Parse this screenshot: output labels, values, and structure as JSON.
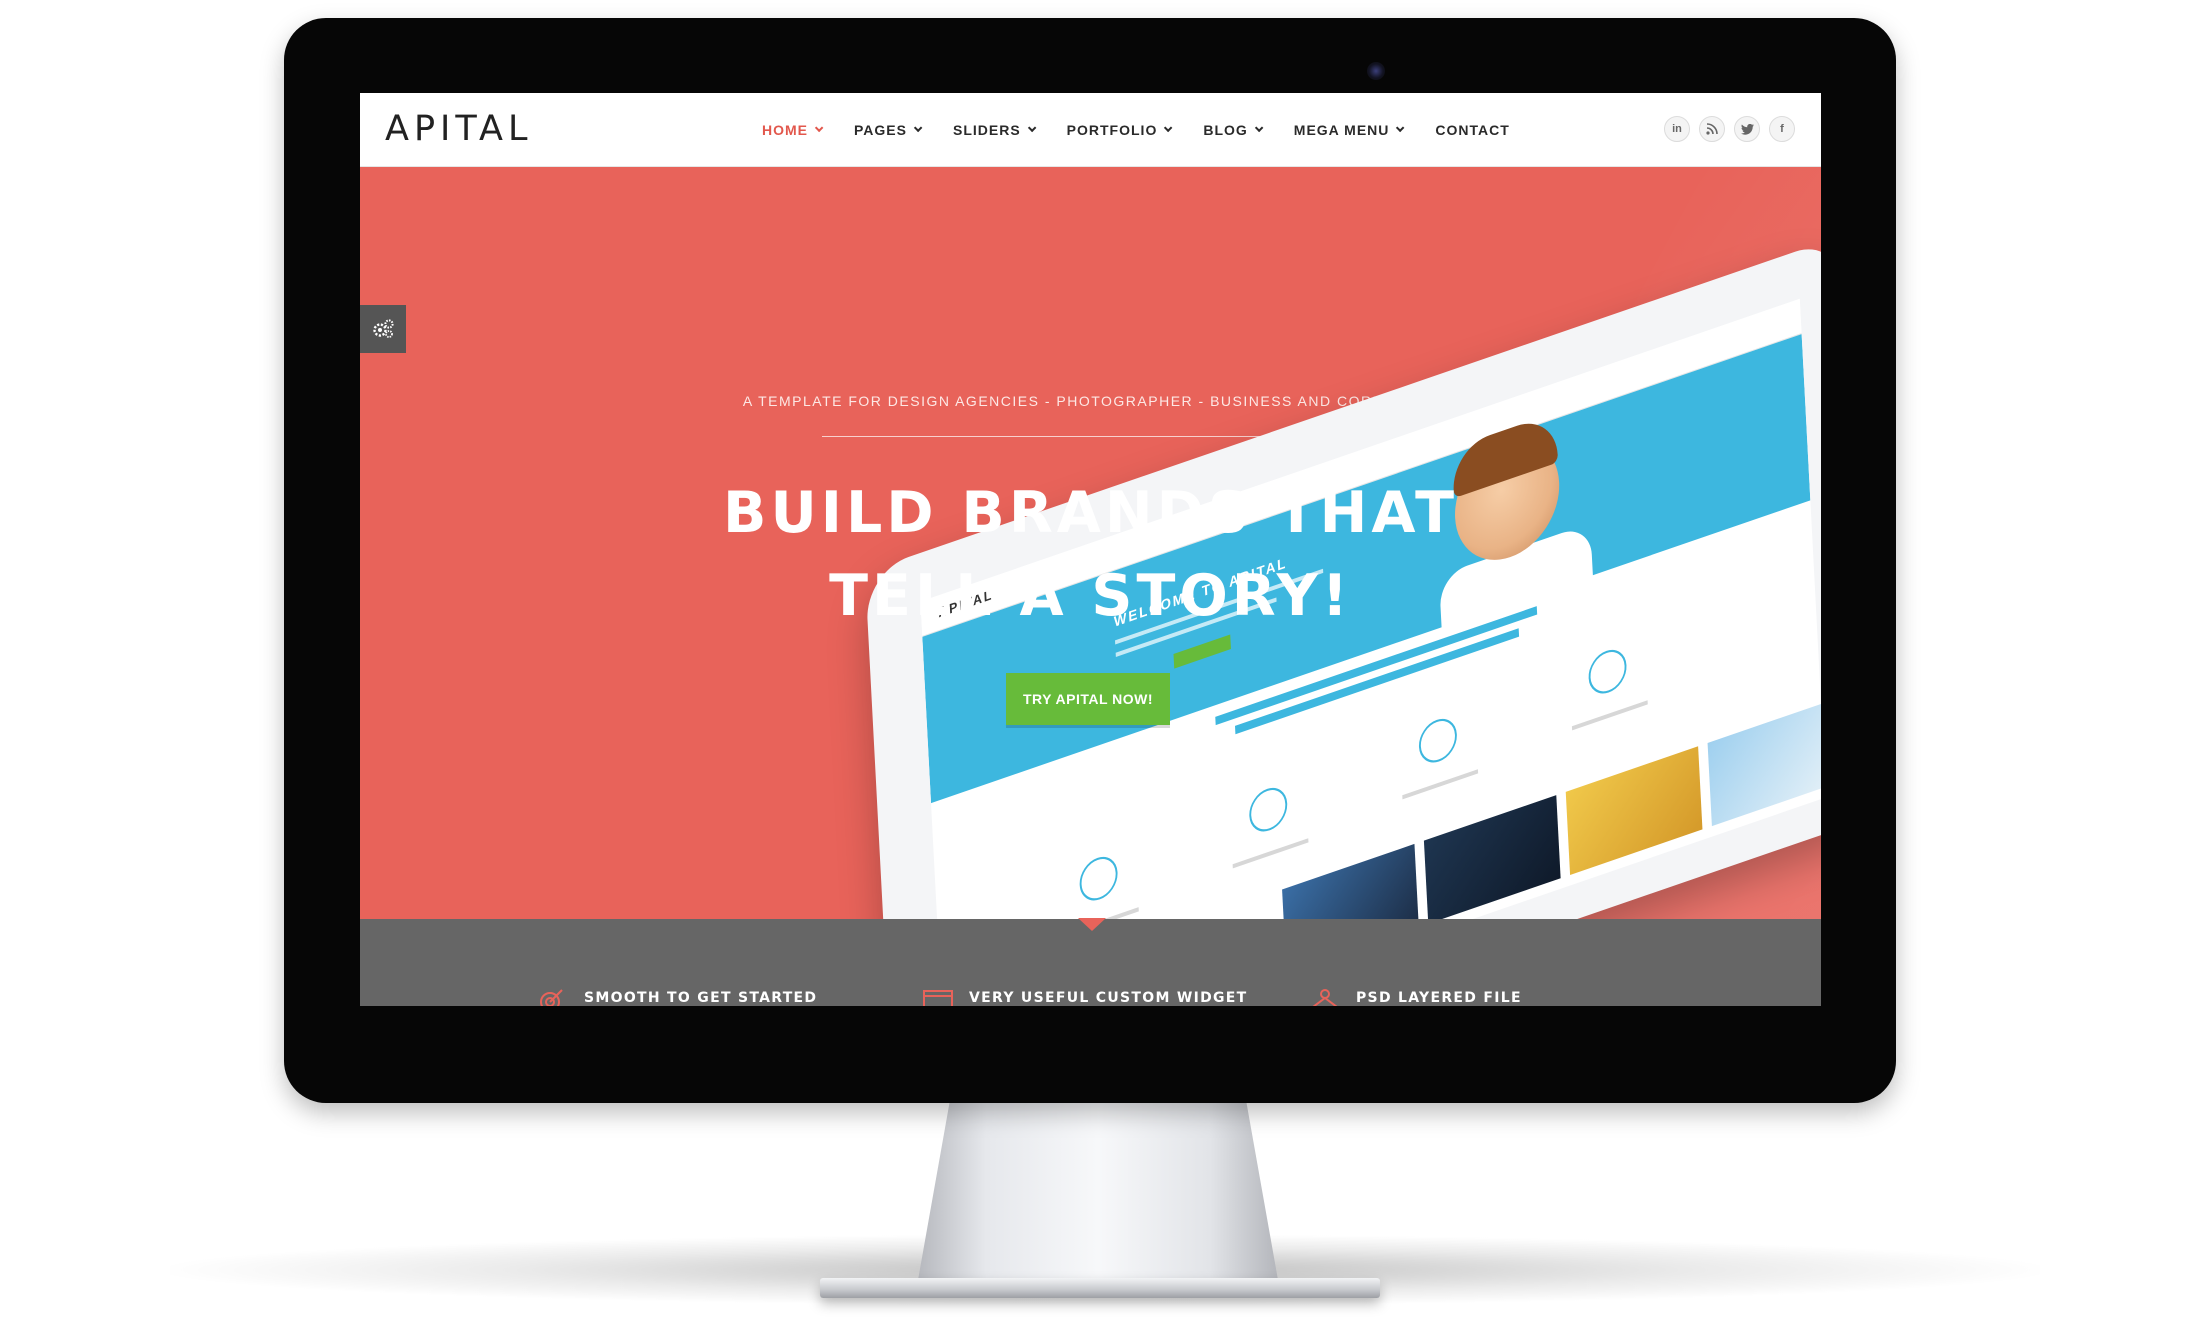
{
  "site": {
    "logo": "APITAL",
    "nav": [
      {
        "label": "HOME",
        "active": true,
        "dropdown": true
      },
      {
        "label": "PAGES",
        "active": false,
        "dropdown": true
      },
      {
        "label": "SLIDERS",
        "active": false,
        "dropdown": true
      },
      {
        "label": "PORTFOLIO",
        "active": false,
        "dropdown": true
      },
      {
        "label": "BLOG",
        "active": false,
        "dropdown": true
      },
      {
        "label": "MEGA MENU",
        "active": false,
        "dropdown": true
      },
      {
        "label": "CONTACT",
        "active": false,
        "dropdown": false
      }
    ],
    "socials": [
      {
        "icon": "linkedin-icon",
        "glyph": "in"
      },
      {
        "icon": "rss-icon",
        "glyph": "⊃"
      },
      {
        "icon": "twitter-icon",
        "glyph": "t"
      },
      {
        "icon": "facebook-icon",
        "glyph": "f"
      }
    ]
  },
  "hero": {
    "tagline": "A TEMPLATE FOR DESIGN AGENCIES - PHOTOGRAPHER - BUSINESS AND CORPORATE",
    "headline_line1": "BUILD BRANDS THAT",
    "headline_line2": "TELL A STORY!",
    "cta_label": "TRY APITAL NOW!",
    "settings_icon": "gears-icon"
  },
  "tablet_preview": {
    "logo": "APITAL",
    "title": "WELCOME TO APITAL"
  },
  "features": [
    {
      "icon": "target-icon",
      "label": "SMOOTH TO GET STARTED"
    },
    {
      "icon": "widget-icon",
      "label": "VERY USEFUL CUSTOM WIDGET"
    },
    {
      "icon": "layers-icon",
      "label": "PSD LAYERED FILE"
    }
  ],
  "colors": {
    "hero_bg": "#e8635a",
    "accent": "#e2574c",
    "cta": "#67bb3a",
    "strip": "#666666",
    "tablet_hero": "#3db7df"
  }
}
